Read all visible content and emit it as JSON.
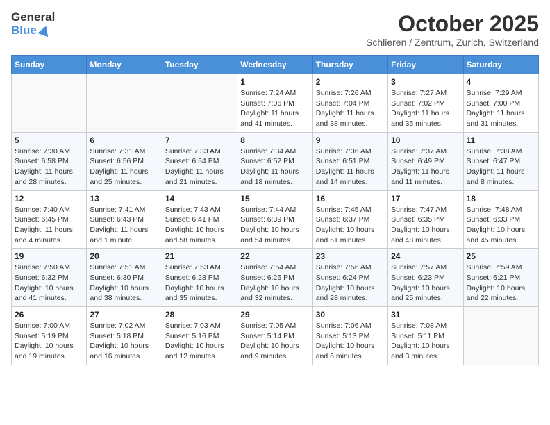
{
  "header": {
    "logo_general": "General",
    "logo_blue": "Blue",
    "month": "October 2025",
    "location": "Schlieren / Zentrum, Zurich, Switzerland"
  },
  "weekdays": [
    "Sunday",
    "Monday",
    "Tuesday",
    "Wednesday",
    "Thursday",
    "Friday",
    "Saturday"
  ],
  "weeks": [
    [
      {
        "day": "",
        "sunrise": "",
        "sunset": "",
        "daylight": ""
      },
      {
        "day": "",
        "sunrise": "",
        "sunset": "",
        "daylight": ""
      },
      {
        "day": "",
        "sunrise": "",
        "sunset": "",
        "daylight": ""
      },
      {
        "day": "1",
        "sunrise": "Sunrise: 7:24 AM",
        "sunset": "Sunset: 7:06 PM",
        "daylight": "Daylight: 11 hours and 41 minutes."
      },
      {
        "day": "2",
        "sunrise": "Sunrise: 7:26 AM",
        "sunset": "Sunset: 7:04 PM",
        "daylight": "Daylight: 11 hours and 38 minutes."
      },
      {
        "day": "3",
        "sunrise": "Sunrise: 7:27 AM",
        "sunset": "Sunset: 7:02 PM",
        "daylight": "Daylight: 11 hours and 35 minutes."
      },
      {
        "day": "4",
        "sunrise": "Sunrise: 7:29 AM",
        "sunset": "Sunset: 7:00 PM",
        "daylight": "Daylight: 11 hours and 31 minutes."
      }
    ],
    [
      {
        "day": "5",
        "sunrise": "Sunrise: 7:30 AM",
        "sunset": "Sunset: 6:58 PM",
        "daylight": "Daylight: 11 hours and 28 minutes."
      },
      {
        "day": "6",
        "sunrise": "Sunrise: 7:31 AM",
        "sunset": "Sunset: 6:56 PM",
        "daylight": "Daylight: 11 hours and 25 minutes."
      },
      {
        "day": "7",
        "sunrise": "Sunrise: 7:33 AM",
        "sunset": "Sunset: 6:54 PM",
        "daylight": "Daylight: 11 hours and 21 minutes."
      },
      {
        "day": "8",
        "sunrise": "Sunrise: 7:34 AM",
        "sunset": "Sunset: 6:52 PM",
        "daylight": "Daylight: 11 hours and 18 minutes."
      },
      {
        "day": "9",
        "sunrise": "Sunrise: 7:36 AM",
        "sunset": "Sunset: 6:51 PM",
        "daylight": "Daylight: 11 hours and 14 minutes."
      },
      {
        "day": "10",
        "sunrise": "Sunrise: 7:37 AM",
        "sunset": "Sunset: 6:49 PM",
        "daylight": "Daylight: 11 hours and 11 minutes."
      },
      {
        "day": "11",
        "sunrise": "Sunrise: 7:38 AM",
        "sunset": "Sunset: 6:47 PM",
        "daylight": "Daylight: 11 hours and 8 minutes."
      }
    ],
    [
      {
        "day": "12",
        "sunrise": "Sunrise: 7:40 AM",
        "sunset": "Sunset: 6:45 PM",
        "daylight": "Daylight: 11 hours and 4 minutes."
      },
      {
        "day": "13",
        "sunrise": "Sunrise: 7:41 AM",
        "sunset": "Sunset: 6:43 PM",
        "daylight": "Daylight: 11 hours and 1 minute."
      },
      {
        "day": "14",
        "sunrise": "Sunrise: 7:43 AM",
        "sunset": "Sunset: 6:41 PM",
        "daylight": "Daylight: 10 hours and 58 minutes."
      },
      {
        "day": "15",
        "sunrise": "Sunrise: 7:44 AM",
        "sunset": "Sunset: 6:39 PM",
        "daylight": "Daylight: 10 hours and 54 minutes."
      },
      {
        "day": "16",
        "sunrise": "Sunrise: 7:45 AM",
        "sunset": "Sunset: 6:37 PM",
        "daylight": "Daylight: 10 hours and 51 minutes."
      },
      {
        "day": "17",
        "sunrise": "Sunrise: 7:47 AM",
        "sunset": "Sunset: 6:35 PM",
        "daylight": "Daylight: 10 hours and 48 minutes."
      },
      {
        "day": "18",
        "sunrise": "Sunrise: 7:48 AM",
        "sunset": "Sunset: 6:33 PM",
        "daylight": "Daylight: 10 hours and 45 minutes."
      }
    ],
    [
      {
        "day": "19",
        "sunrise": "Sunrise: 7:50 AM",
        "sunset": "Sunset: 6:32 PM",
        "daylight": "Daylight: 10 hours and 41 minutes."
      },
      {
        "day": "20",
        "sunrise": "Sunrise: 7:51 AM",
        "sunset": "Sunset: 6:30 PM",
        "daylight": "Daylight: 10 hours and 38 minutes."
      },
      {
        "day": "21",
        "sunrise": "Sunrise: 7:53 AM",
        "sunset": "Sunset: 6:28 PM",
        "daylight": "Daylight: 10 hours and 35 minutes."
      },
      {
        "day": "22",
        "sunrise": "Sunrise: 7:54 AM",
        "sunset": "Sunset: 6:26 PM",
        "daylight": "Daylight: 10 hours and 32 minutes."
      },
      {
        "day": "23",
        "sunrise": "Sunrise: 7:56 AM",
        "sunset": "Sunset: 6:24 PM",
        "daylight": "Daylight: 10 hours and 28 minutes."
      },
      {
        "day": "24",
        "sunrise": "Sunrise: 7:57 AM",
        "sunset": "Sunset: 6:23 PM",
        "daylight": "Daylight: 10 hours and 25 minutes."
      },
      {
        "day": "25",
        "sunrise": "Sunrise: 7:59 AM",
        "sunset": "Sunset: 6:21 PM",
        "daylight": "Daylight: 10 hours and 22 minutes."
      }
    ],
    [
      {
        "day": "26",
        "sunrise": "Sunrise: 7:00 AM",
        "sunset": "Sunset: 5:19 PM",
        "daylight": "Daylight: 10 hours and 19 minutes."
      },
      {
        "day": "27",
        "sunrise": "Sunrise: 7:02 AM",
        "sunset": "Sunset: 5:18 PM",
        "daylight": "Daylight: 10 hours and 16 minutes."
      },
      {
        "day": "28",
        "sunrise": "Sunrise: 7:03 AM",
        "sunset": "Sunset: 5:16 PM",
        "daylight": "Daylight: 10 hours and 12 minutes."
      },
      {
        "day": "29",
        "sunrise": "Sunrise: 7:05 AM",
        "sunset": "Sunset: 5:14 PM",
        "daylight": "Daylight: 10 hours and 9 minutes."
      },
      {
        "day": "30",
        "sunrise": "Sunrise: 7:06 AM",
        "sunset": "Sunset: 5:13 PM",
        "daylight": "Daylight: 10 hours and 6 minutes."
      },
      {
        "day": "31",
        "sunrise": "Sunrise: 7:08 AM",
        "sunset": "Sunset: 5:11 PM",
        "daylight": "Daylight: 10 hours and 3 minutes."
      },
      {
        "day": "",
        "sunrise": "",
        "sunset": "",
        "daylight": ""
      }
    ]
  ]
}
